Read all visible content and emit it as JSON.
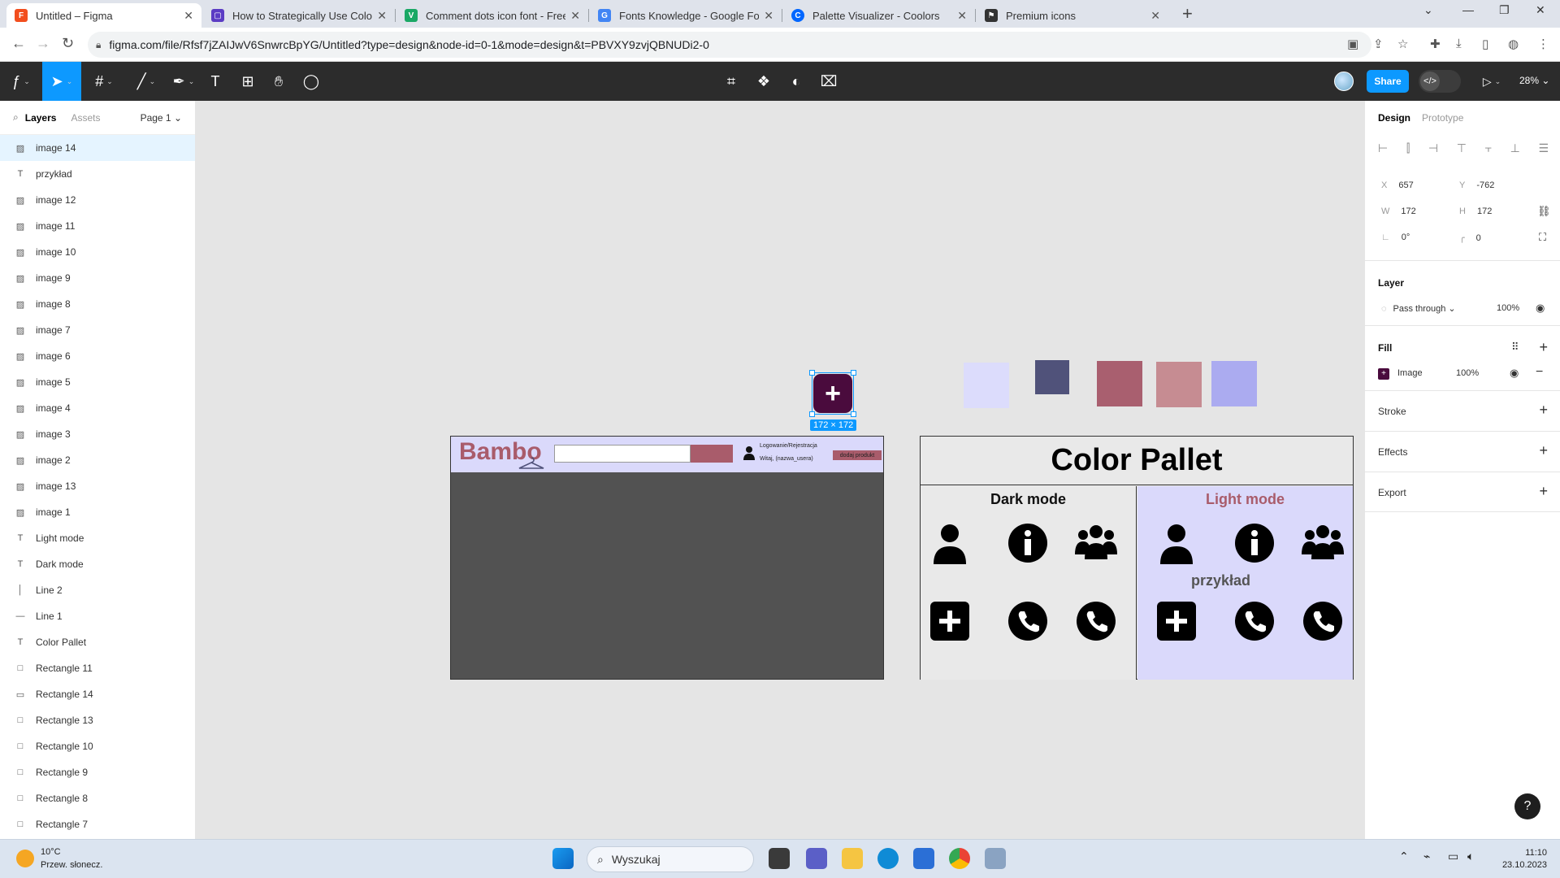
{
  "browser": {
    "tabs": [
      {
        "title": "Untitled – Figma",
        "favicon": "figma-icon",
        "color": "#f24e1e"
      },
      {
        "title": "How to Strategically Use Color in",
        "favicon": "article-icon",
        "color": "#5b3cc4"
      },
      {
        "title": "Comment dots icon font - Free c",
        "favicon": "vuetify-icon",
        "color": "#1aa865"
      },
      {
        "title": "Fonts Knowledge - Google Fonts",
        "favicon": "google-fonts-icon",
        "color": "#4285f4"
      },
      {
        "title": "Palette Visualizer - Coolors",
        "favicon": "coolors-icon",
        "color": "#0066ff"
      },
      {
        "title": "Premium icons",
        "favicon": "fontawesome-icon",
        "color": "#333333"
      }
    ],
    "url": "figma.com/file/Rfsf7jZAIJwV6SnwrcBpYG/Untitled?type=design&node-id=0-1&mode=design&t=PBVXY9zvjQBNUDi2-0"
  },
  "figma_toolbar": {
    "share_label": "Share",
    "zoom": "28%"
  },
  "left_panel": {
    "tabs": {
      "layers": "Layers",
      "assets": "Assets"
    },
    "page": "Page 1",
    "layers": [
      {
        "name": "image 14",
        "type": "image",
        "selected": true
      },
      {
        "name": "przykład",
        "type": "text"
      },
      {
        "name": "image 12",
        "type": "image"
      },
      {
        "name": "image 11",
        "type": "image"
      },
      {
        "name": "image 10",
        "type": "image"
      },
      {
        "name": "image 9",
        "type": "image"
      },
      {
        "name": "image 8",
        "type": "image"
      },
      {
        "name": "image 7",
        "type": "image"
      },
      {
        "name": "image 6",
        "type": "image"
      },
      {
        "name": "image 5",
        "type": "image"
      },
      {
        "name": "image 4",
        "type": "image"
      },
      {
        "name": "image 3",
        "type": "image"
      },
      {
        "name": "image 2",
        "type": "image"
      },
      {
        "name": "image 13",
        "type": "image"
      },
      {
        "name": "image 1",
        "type": "image"
      },
      {
        "name": "Light mode",
        "type": "text"
      },
      {
        "name": "Dark mode",
        "type": "text"
      },
      {
        "name": "Line 2",
        "type": "vline"
      },
      {
        "name": "Line 1",
        "type": "hline"
      },
      {
        "name": "Color Pallet",
        "type": "text"
      },
      {
        "name": "Rectangle 11",
        "type": "rect"
      },
      {
        "name": "Rectangle 14",
        "type": "rectline"
      },
      {
        "name": "Rectangle 13",
        "type": "rect"
      },
      {
        "name": "Rectangle 10",
        "type": "rect"
      },
      {
        "name": "Rectangle 9",
        "type": "rect"
      },
      {
        "name": "Rectangle 8",
        "type": "rect"
      },
      {
        "name": "Rectangle 7",
        "type": "rect"
      }
    ]
  },
  "canvas": {
    "website": {
      "logo": "Bambo",
      "login": "Logowanie/Rejestracja",
      "hello": "Witaj, (nazwa_usera)",
      "add_product": "dodaj produkt"
    },
    "selection_label": "172 × 172",
    "swatches": [
      "#dcdcfc",
      "#50527a",
      "#a95f6f",
      "#c68c92",
      "#ababf0"
    ],
    "palette": {
      "title": "Color Pallet",
      "dark_title": "Dark mode",
      "light_title": "Light mode",
      "example": "przykład",
      "light_title_color": "#a95c6b",
      "light_bg": "#dad9fb"
    }
  },
  "right_panel": {
    "tabs": {
      "design": "Design",
      "prototype": "Prototype"
    },
    "x": "657",
    "y": "-762",
    "w": "172",
    "h": "172",
    "rotation": "0°",
    "radius": "0",
    "layer_title": "Layer",
    "blend": "Pass through",
    "layer_opacity": "100%",
    "fill_title": "Fill",
    "fill_type": "Image",
    "fill_opacity": "100%",
    "stroke": "Stroke",
    "effects": "Effects",
    "export": "Export"
  },
  "taskbar": {
    "temperature": "10°C",
    "weather": "Przew. słonecz.",
    "search": "Wyszukaj",
    "time": "11:10",
    "date": "23.10.2023"
  }
}
